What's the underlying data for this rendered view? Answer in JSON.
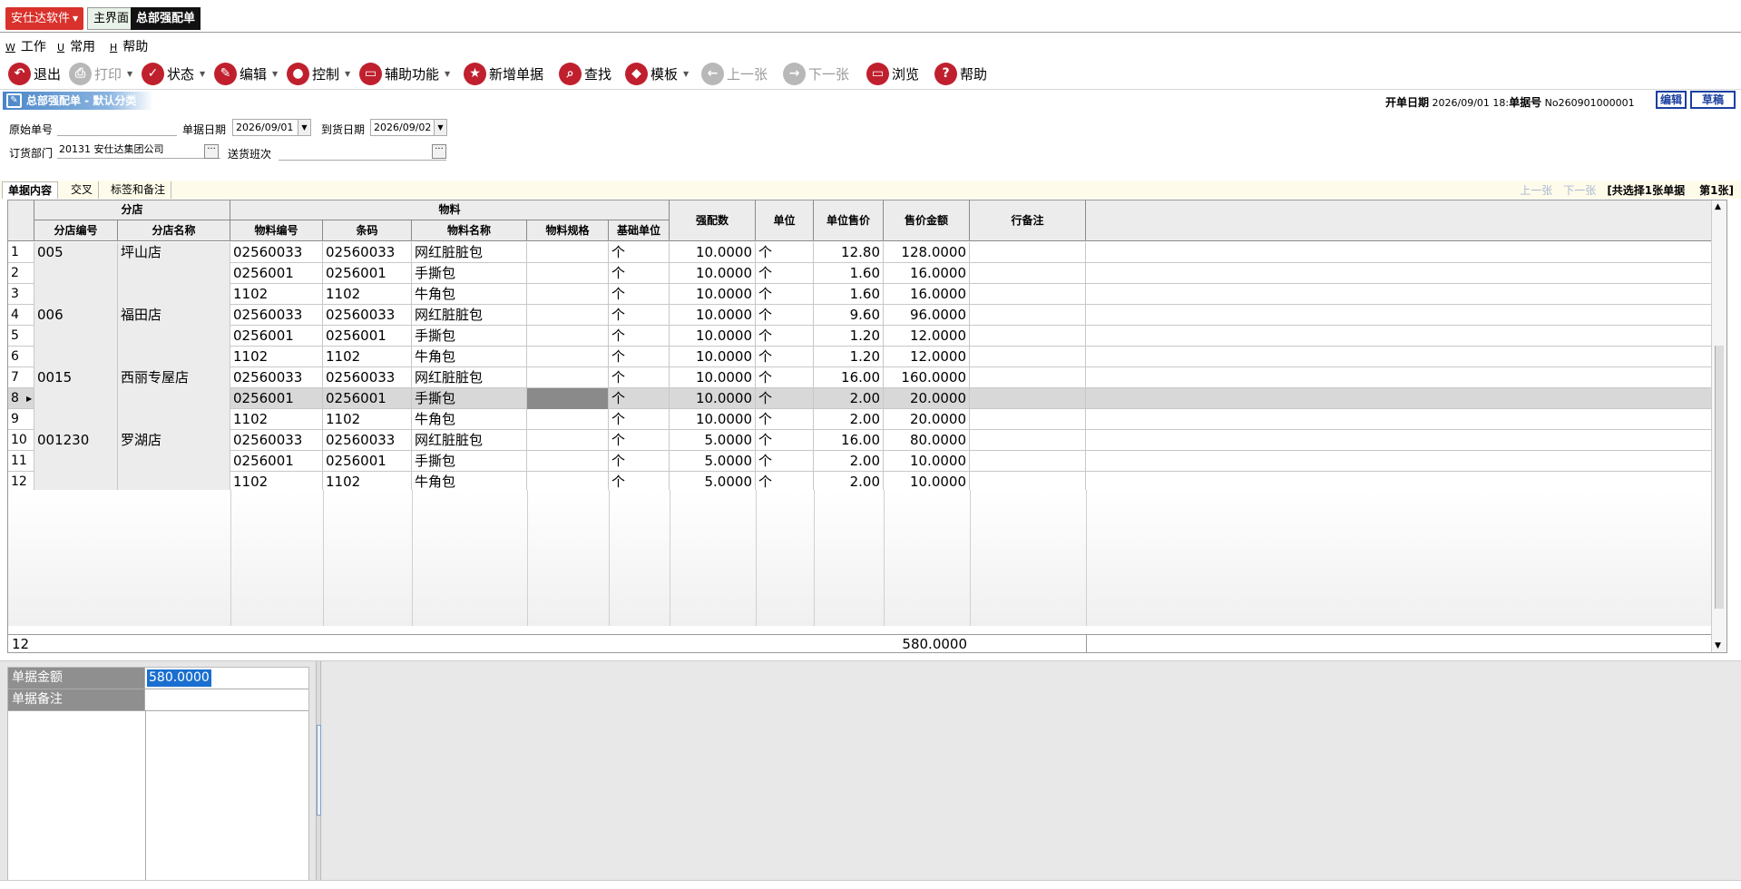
{
  "brand": "安仕达软件",
  "tabs": {
    "main": "主界面",
    "active": "总部强配单"
  },
  "menu": [
    {
      "key": "W",
      "label": "工作"
    },
    {
      "key": "U",
      "label": "常用"
    },
    {
      "key": "H",
      "label": "帮助"
    }
  ],
  "toolbar": {
    "exit": "退出",
    "print": "打印",
    "status": "状态",
    "edit": "编辑",
    "control": "控制",
    "aux": "辅助功能",
    "new": "新增单据",
    "find": "查找",
    "template": "模板",
    "prev": "上一张",
    "next": "下一张",
    "browse": "浏览",
    "help": "帮助"
  },
  "doc": {
    "title": "总部强配单 - 默认分类",
    "open_date_label": "开单日期",
    "open_date": "2026/09/01 18:",
    "doc_no_label": "单据号",
    "doc_no": "No260901000001",
    "edit_flag": "编辑",
    "draft_flag": "草稿"
  },
  "form": {
    "orig_no_label": "原始单号",
    "orig_no": "",
    "doc_date_label": "单据日期",
    "doc_date": "2026/09/01",
    "arrive_date_label": "到货日期",
    "arrive_date": "2026/09/02",
    "dept_label": "订货部门",
    "dept": "20131  安仕达集团公司",
    "shift_label": "送货班次",
    "shift": ""
  },
  "content_tabs": [
    "单据内容",
    "交叉",
    "标签和备注"
  ],
  "nav": {
    "prev": "上一张",
    "next": "下一张",
    "count": "[共选择1张单据",
    "page": "第1张]"
  },
  "grid": {
    "group_store": "分店",
    "group_item": "物料",
    "headers": {
      "store_code": "分店编号",
      "store_name": "分店名称",
      "item_code": "物料编号",
      "barcode": "条码",
      "item_name": "物料名称",
      "spec": "物料规格",
      "base_unit": "基础单位",
      "qty": "强配数",
      "unit": "单位",
      "price": "单位售价",
      "amount": "售价金额",
      "note": "行备注"
    },
    "rows": [
      {
        "n": "1",
        "store_code": "005",
        "store_name": "坪山店",
        "item_code": "02560033",
        "barcode": "02560033",
        "item_name": "网红脏脏包",
        "base_unit": "个",
        "qty": "10.0000",
        "unit": "个",
        "price": "12.80",
        "amount": "128.0000"
      },
      {
        "n": "2",
        "store_code": "",
        "store_name": "",
        "item_code": "0256001",
        "barcode": "0256001",
        "item_name": "手撕包",
        "base_unit": "个",
        "qty": "10.0000",
        "unit": "个",
        "price": "1.60",
        "amount": "16.0000"
      },
      {
        "n": "3",
        "store_code": "",
        "store_name": "",
        "item_code": "1102",
        "barcode": "1102",
        "item_name": "牛角包",
        "base_unit": "个",
        "qty": "10.0000",
        "unit": "个",
        "price": "1.60",
        "amount": "16.0000"
      },
      {
        "n": "4",
        "store_code": "006",
        "store_name": "福田店",
        "item_code": "02560033",
        "barcode": "02560033",
        "item_name": "网红脏脏包",
        "base_unit": "个",
        "qty": "10.0000",
        "unit": "个",
        "price": "9.60",
        "amount": "96.0000"
      },
      {
        "n": "5",
        "store_code": "",
        "store_name": "",
        "item_code": "0256001",
        "barcode": "0256001",
        "item_name": "手撕包",
        "base_unit": "个",
        "qty": "10.0000",
        "unit": "个",
        "price": "1.20",
        "amount": "12.0000"
      },
      {
        "n": "6",
        "store_code": "",
        "store_name": "",
        "item_code": "1102",
        "barcode": "1102",
        "item_name": "牛角包",
        "base_unit": "个",
        "qty": "10.0000",
        "unit": "个",
        "price": "1.20",
        "amount": "12.0000"
      },
      {
        "n": "7",
        "store_code": "0015",
        "store_name": "西丽专屋店",
        "item_code": "02560033",
        "barcode": "02560033",
        "item_name": "网红脏脏包",
        "base_unit": "个",
        "qty": "10.0000",
        "unit": "个",
        "price": "16.00",
        "amount": "160.0000"
      },
      {
        "n": "8",
        "store_code": "",
        "store_name": "",
        "item_code": "0256001",
        "barcode": "0256001",
        "item_name": "手撕包",
        "base_unit": "个",
        "qty": "10.0000",
        "unit": "个",
        "price": "2.00",
        "amount": "20.0000"
      },
      {
        "n": "9",
        "store_code": "",
        "store_name": "",
        "item_code": "1102",
        "barcode": "1102",
        "item_name": "牛角包",
        "base_unit": "个",
        "qty": "10.0000",
        "unit": "个",
        "price": "2.00",
        "amount": "20.0000"
      },
      {
        "n": "10",
        "store_code": "001230",
        "store_name": "罗湖店",
        "item_code": "02560033",
        "barcode": "02560033",
        "item_name": "网红脏脏包",
        "base_unit": "个",
        "qty": "5.0000",
        "unit": "个",
        "price": "16.00",
        "amount": "80.0000"
      },
      {
        "n": "11",
        "store_code": "",
        "store_name": "",
        "item_code": "0256001",
        "barcode": "0256001",
        "item_name": "手撕包",
        "base_unit": "个",
        "qty": "5.0000",
        "unit": "个",
        "price": "2.00",
        "amount": "10.0000"
      },
      {
        "n": "12",
        "store_code": "",
        "store_name": "",
        "item_code": "1102",
        "barcode": "1102",
        "item_name": "牛角包",
        "base_unit": "个",
        "qty": "5.0000",
        "unit": "个",
        "price": "2.00",
        "amount": "10.0000"
      }
    ],
    "footer_count": "12",
    "footer_total": "580.0000"
  },
  "summary": {
    "amount_label": "单据金额",
    "amount": "580.0000",
    "note_label": "单据备注",
    "note": ""
  }
}
